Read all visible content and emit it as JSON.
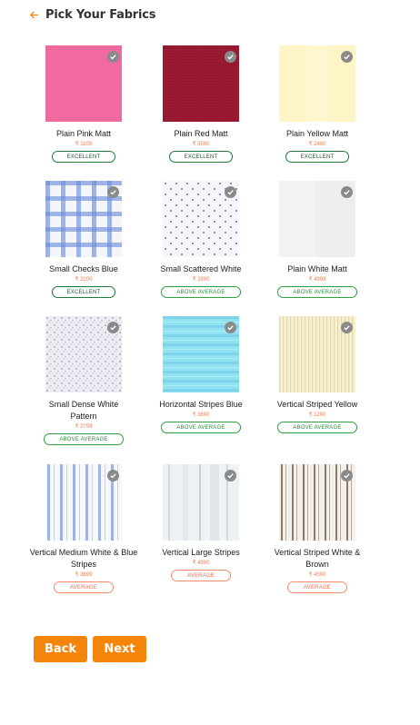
{
  "header": {
    "title": "Pick Your Fabrics",
    "back_icon": "arrow-left-icon",
    "accent": "#f5840b"
  },
  "fabrics": [
    {
      "name": "Plain Pink Matt",
      "price": "₹ 1100",
      "rating": "EXCELLENT"
    },
    {
      "name": "Plain Red Matt",
      "price": "₹ 3500",
      "rating": "EXCELLENT"
    },
    {
      "name": "Plain Yellow Matt",
      "price": "₹ 2400",
      "rating": "EXCELLENT"
    },
    {
      "name": "Small Checks Blue",
      "price": "₹ 2200",
      "rating": "EXCELLENT"
    },
    {
      "name": "Small Scattered White",
      "price": "₹ 2800",
      "rating": "ABOVE AVERAGE"
    },
    {
      "name": "Plain White Matt",
      "price": "₹ 4999",
      "rating": "ABOVE AVERAGE"
    },
    {
      "name": "Small Dense White Pattern",
      "price": "₹ 2799",
      "rating": "ABOVE AVERAGE"
    },
    {
      "name": "Horizontal Stripes Blue",
      "price": "₹ 3600",
      "rating": "ABOVE AVERAGE"
    },
    {
      "name": "Vertical Striped Yellow",
      "price": "₹ 1200",
      "rating": "ABOVE AVERAGE"
    },
    {
      "name": "Vertical Medium White & Blue Stripes",
      "price": "₹ 3699",
      "rating": "AVERAGE"
    },
    {
      "name": "Vertical Large Stripes",
      "price": "₹ 4900",
      "rating": "AVERAGE"
    },
    {
      "name": "Vertical Striped White & Brown",
      "price": "₹ 4500",
      "rating": "AVERAGE"
    }
  ],
  "buttons": {
    "back_label": "Back",
    "next_label": "Next"
  }
}
